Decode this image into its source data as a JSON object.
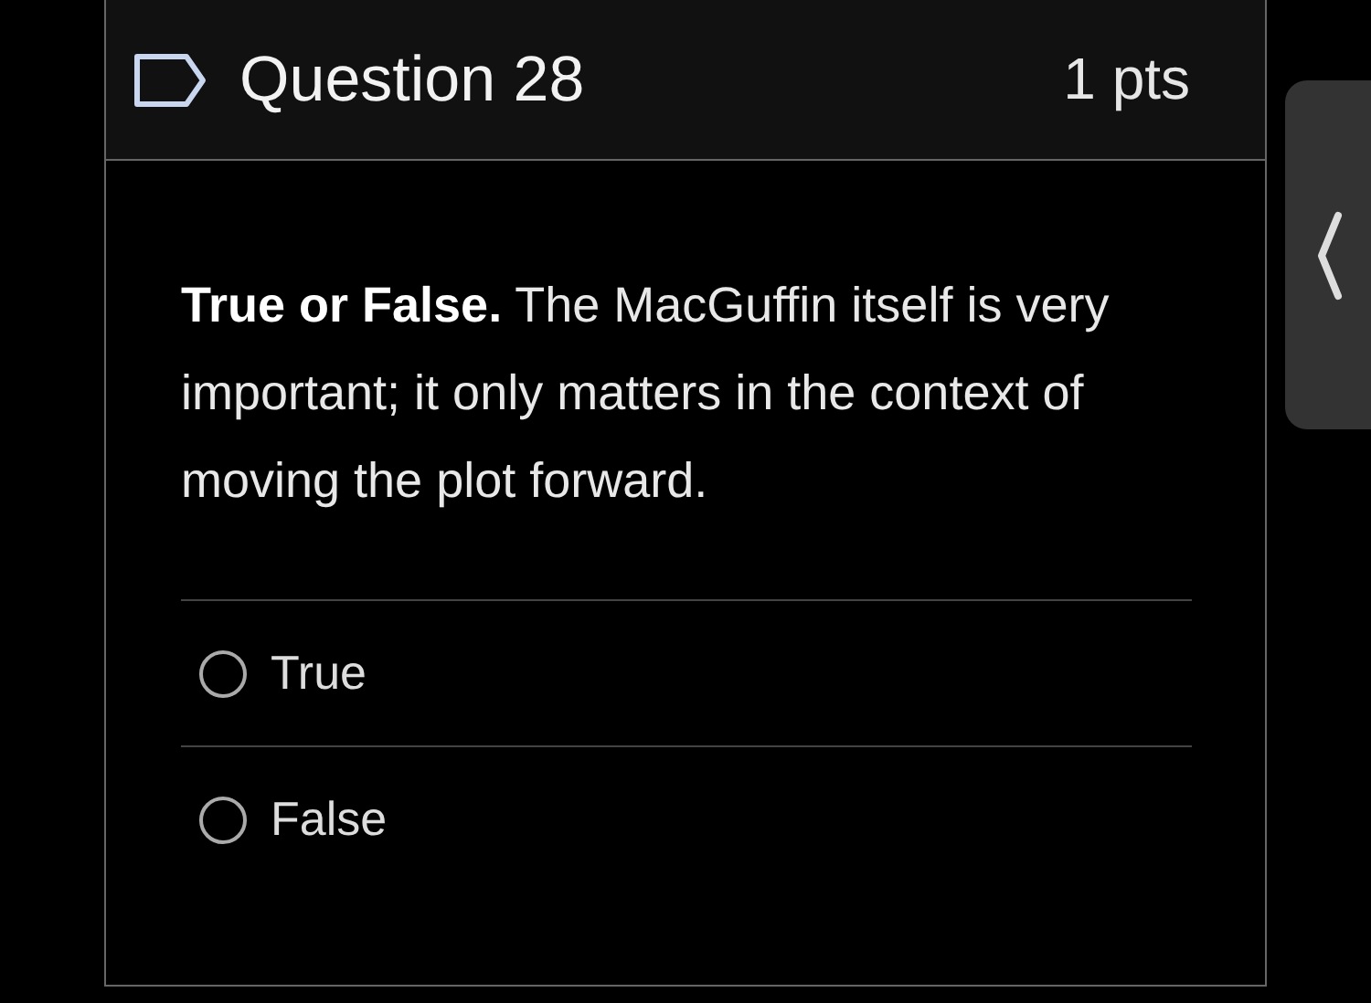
{
  "question": {
    "title": "Question 28",
    "points": "1 pts",
    "flagged": false,
    "text": "**True or False.** The MacGuffin itself is very important; it only matters in the context of moving the plot forward."
  },
  "answers": [
    {
      "label": "True",
      "selected": false
    },
    {
      "label": "False",
      "selected": false
    }
  ]
}
